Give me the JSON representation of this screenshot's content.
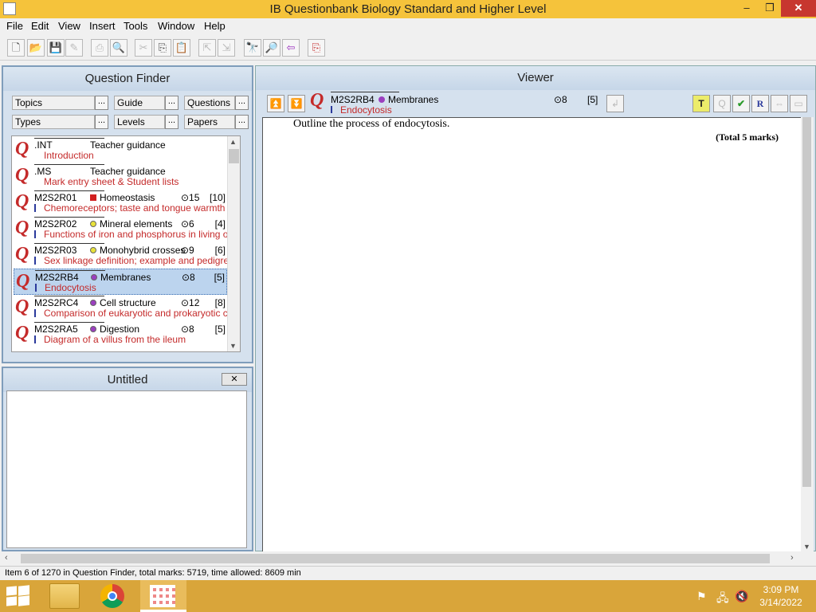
{
  "window": {
    "title": "IB Questionbank Biology Standard and Higher Level",
    "minimize": "–",
    "restore": "❐",
    "close": "✕"
  },
  "menu": [
    "File",
    "Edit",
    "View",
    "Insert",
    "Tools",
    "Window",
    "Help"
  ],
  "question_finder": {
    "title": "Question Finder",
    "filters": {
      "topics": "Topics",
      "guide": "Guide",
      "questions": "Questions",
      "types": "Types",
      "levels": "Levels",
      "papers": "Papers",
      "more": "..."
    },
    "items": [
      {
        "code": ".INT",
        "topic": "Teacher guidance",
        "desc": "Introduction",
        "time": "",
        "marks": "",
        "color": ""
      },
      {
        "code": ".MS",
        "topic": "Teacher guidance",
        "desc": "Mark entry sheet & Student lists",
        "time": "",
        "marks": "",
        "color": ""
      },
      {
        "code": "M2S2R01",
        "topic": "Homeostasis",
        "desc": "Chemoreceptors; taste and tongue warmth",
        "time": "⊙15",
        "marks": "[10]",
        "color": "#d11f1f"
      },
      {
        "code": "M2S2R02",
        "topic": "Mineral elements",
        "desc": "Functions of iron and phosphorus in living organis",
        "time": "⊙6",
        "marks": "[4]",
        "color": "#e8e23a"
      },
      {
        "code": "M2S2R03",
        "topic": "Monohybrid crosses",
        "desc": "Sex linkage definition; example and pedigree",
        "time": "⊙9",
        "marks": "[6]",
        "color": "#e8e23a"
      },
      {
        "code": "M2S2RB4",
        "topic": "Membranes",
        "desc": "Endocytosis",
        "time": "⊙8",
        "marks": "[5]",
        "color": "#9b3fbf"
      },
      {
        "code": "M2S2RC4",
        "topic": "Cell structure",
        "desc": "Comparison of eukaryotic and prokaryotic cells",
        "time": "⊙12",
        "marks": "[8]",
        "color": "#9b3fbf"
      },
      {
        "code": "M2S2RA5",
        "topic": "Digestion",
        "desc": "Diagram of a villus from the ileum",
        "time": "⊙8",
        "marks": "[5]",
        "color": "#9b3fbf"
      }
    ]
  },
  "untitled": {
    "title": "Untitled",
    "close": "✕"
  },
  "viewer": {
    "title": "Viewer",
    "header": {
      "code": "M2S2RB4",
      "topic": "Membranes",
      "desc": "Endocytosis",
      "time": "⊙8",
      "marks": "[5]"
    },
    "question_text": "Outline the process of endocytosis.",
    "total": "(Total 5 marks)"
  },
  "status": "Item 6 of 1270 in Question Finder, total marks: 5719, time allowed: 8609 min",
  "taskbar": {
    "time": "3:09 PM",
    "date": "3/14/2022"
  },
  "colors": {
    "titlebar": "#f5c33b",
    "taskbar": "#d9a53a",
    "accent": "#c42a2a",
    "selection": "#bcd4ee"
  }
}
